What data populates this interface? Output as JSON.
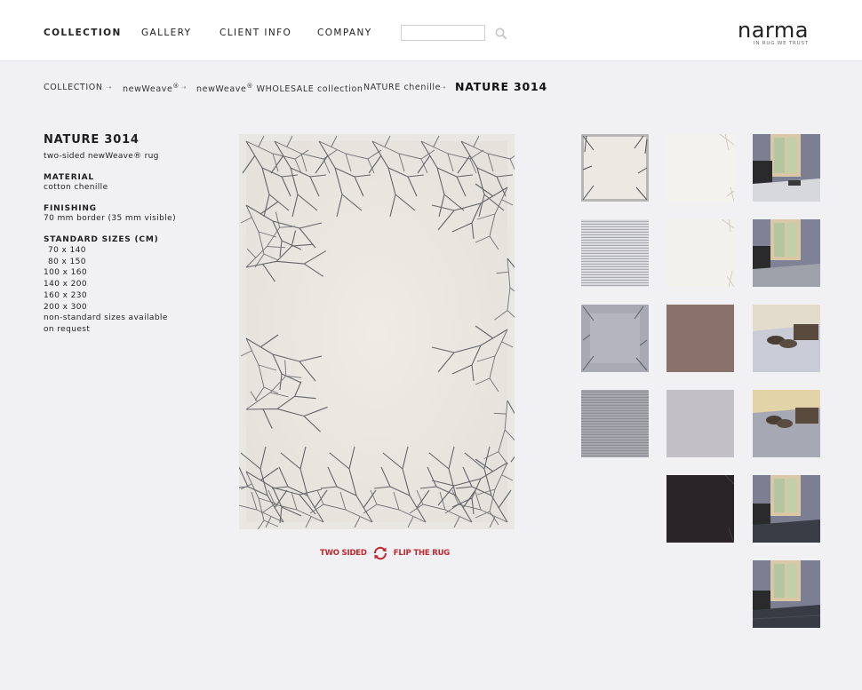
{
  "nav": {
    "items": [
      {
        "label": "COLLECTION"
      },
      {
        "label": "GALLERY"
      },
      {
        "label": "CLIENT INFO"
      },
      {
        "label": "COMPANY"
      }
    ],
    "search_placeholder": ""
  },
  "logo": {
    "word": "narma",
    "tagline": "IN RUG WE TRUST"
  },
  "breadcrumb": {
    "c1": "COLLECTION",
    "c2": "newWeave",
    "c2_sup": "®",
    "c3a": "newWeave",
    "c3_sup": "®",
    "c3b": " WHOLESALE collection",
    "c4": "NATURE chenille",
    "current": "NATURE 3014",
    "separator": "➝"
  },
  "product": {
    "title": "NATURE 3014",
    "subtitle": "two-sided newWeave® rug",
    "material_heading": "MATERIAL",
    "material": "cotton chenille",
    "finishing_heading": "FINISHING",
    "finishing": "70 mm border (35 mm visible)",
    "sizes_heading": "STANDARD SIZES (cm)",
    "sizes": [
      "70 x 140",
      "80 x 150",
      "100 x 160",
      "140 x 200",
      "160 x 230",
      "200 x 300"
    ],
    "sizes_note_1": "non-standard sizes available",
    "sizes_note_2": "on request"
  },
  "flip": {
    "left_label": "TWO SIDED",
    "right_label": "FLIP THE RUG",
    "color": "#c0272d"
  },
  "thumbnails": [
    {
      "name": "nature-front"
    },
    {
      "name": "nature-back"
    },
    {
      "name": "room-interior-1"
    },
    {
      "name": "grey-stripes"
    },
    {
      "name": "nature-back-corner"
    },
    {
      "name": "room-interior-2"
    },
    {
      "name": "grey-nature"
    },
    {
      "name": "brown-chenille"
    },
    {
      "name": "floor-closeup-1"
    },
    {
      "name": "grey-stripes-dark"
    },
    {
      "name": "lilac-grey-chenille"
    },
    {
      "name": "floor-closeup-2"
    },
    {
      "name": "black-chenille"
    },
    {
      "name": "room-interior-3"
    },
    {
      "name": "room-interior-4"
    }
  ],
  "colors": {
    "accent": "#c0272d",
    "background": "#f1f1f3",
    "header": "#ffffff"
  }
}
